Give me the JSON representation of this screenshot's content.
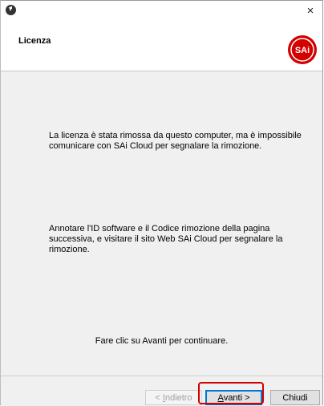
{
  "window": {
    "header_title": "Licenza",
    "close_glyph": "×"
  },
  "logo": {
    "text": "SAi",
    "color": "#d40000"
  },
  "content": {
    "paragraph_1": "La licenza è stata rimossa da questo computer, ma è impossibile comunicare con SAi Cloud per segnalare la rimozione.",
    "paragraph_2": "Annotare l'ID software e il Codice rimozione della pagina successiva, e visitare il sito Web SAi Cloud per segnalare la rimozione.",
    "paragraph_3": "Fare clic su Avanti per continuare."
  },
  "footer": {
    "back_prefix": "< ",
    "back_access": "I",
    "back_rest": "ndietro",
    "next_access": "A",
    "next_rest": "vanti >",
    "close_label": "Chiudi"
  },
  "colors": {
    "accent": "#0078d7",
    "highlight": "#d40000"
  }
}
